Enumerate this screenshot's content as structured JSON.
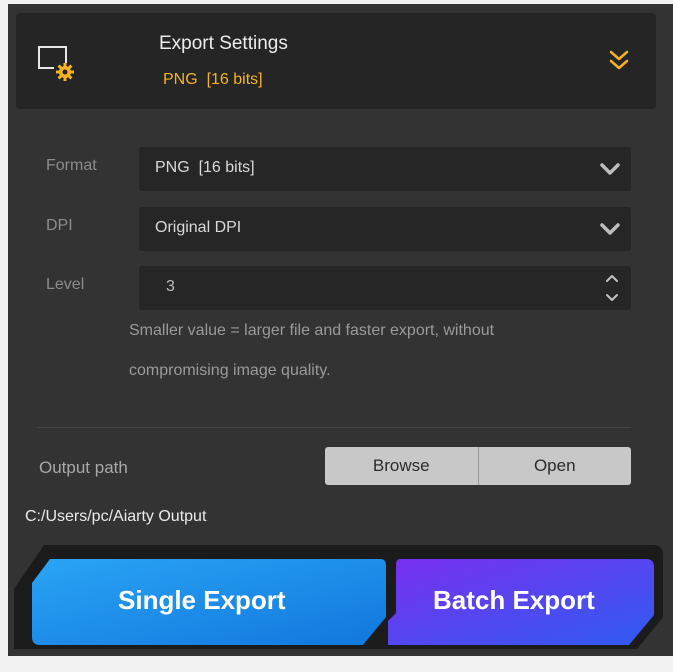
{
  "header": {
    "title": "Export Settings",
    "subtitle": "PNG  [16 bits]",
    "icon": "monitor-gear-icon",
    "expand_icon": "double-chevron-down-icon"
  },
  "format": {
    "label": "Format",
    "value": "PNG  [16 bits]"
  },
  "dpi": {
    "label": "DPI",
    "value": "Original DPI"
  },
  "level": {
    "label": "Level",
    "value": "3",
    "note_line1": "Smaller value = larger file and faster export, without",
    "note_line2": "compromising image quality."
  },
  "output": {
    "label": "Output path",
    "browse_label": "Browse",
    "open_label": "Open",
    "path": "C:/Users/pc/Aiarty Output"
  },
  "export": {
    "single_label": "Single Export",
    "batch_label": "Batch Export"
  },
  "colors": {
    "accent_orange": "#f3b322",
    "single_export_blue": "#1e8fe8",
    "batch_export_violet": "#6a3cf0"
  }
}
